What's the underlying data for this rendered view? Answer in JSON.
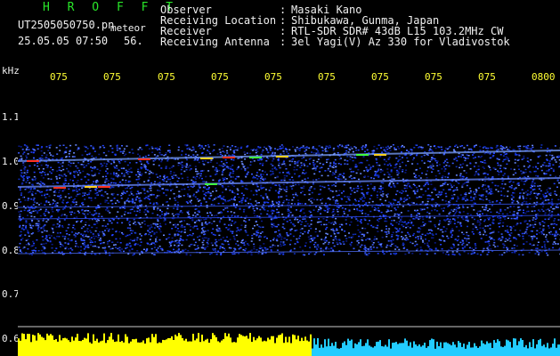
{
  "header": {
    "title": "H R O F F T",
    "filename": "UT2505050750.pn",
    "filename_suffix": "meteor",
    "datetime": "25.05.05 07:50",
    "seconds": "56.",
    "rows": [
      {
        "key": "Observer",
        "sep": ":",
        "value": "Masaki Kano"
      },
      {
        "key": "Receiving Location",
        "sep": ":",
        "value": "Shibukawa, Gunma, Japan"
      },
      {
        "key": "Receiver",
        "sep": ":",
        "value": "RTL-SDR SDR# 43dB L15 103.2MHz CW"
      },
      {
        "key": "Receiving Antenna",
        "sep": ":",
        "value": "3el Yagi(V) Az 330 for Vladivostok"
      }
    ]
  },
  "axis": {
    "unit": "kHz",
    "time_ticks": [
      "075",
      "075",
      "075",
      "075",
      "075",
      "075",
      "075",
      "075",
      "075",
      "0800"
    ],
    "freq_ticks": [
      "1.1",
      "1.0",
      "0.9",
      "0.8",
      "0.7",
      "0.6"
    ]
  },
  "colors": {
    "background": "#000000",
    "title_green": "#29e629",
    "tick_yellow": "#ffff33",
    "signal_blue": "#2040ff",
    "echo_red": "#ff3020",
    "baseline_cyan": "#22ccff",
    "baseline_yellow": "#ffff00"
  }
}
